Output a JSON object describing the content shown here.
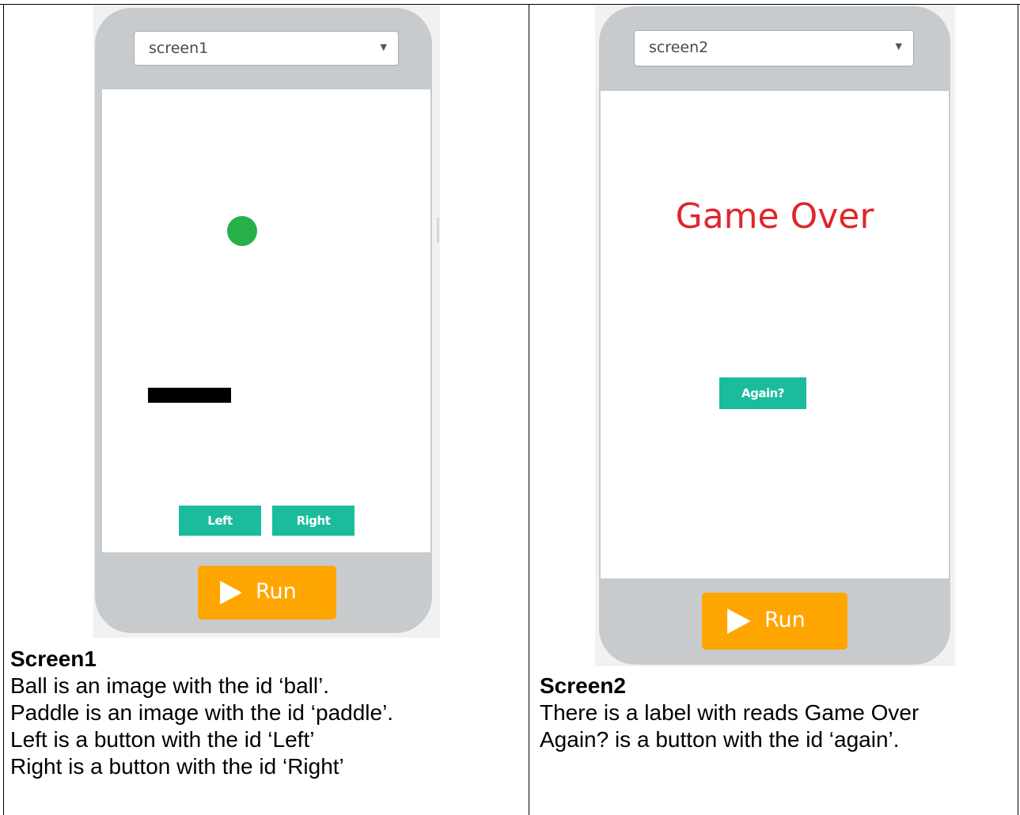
{
  "screen1": {
    "dropdown_value": "screen1",
    "left_button": "Left",
    "right_button": "Right",
    "run_button": "Run",
    "caption_title": "Screen1",
    "caption_lines": [
      "Ball is an image with the id ‘ball’.",
      "Paddle is an image with the id ‘paddle’.",
      "Left is a button with the id ‘Left’",
      "Right is a button with the id ‘Right’"
    ]
  },
  "screen2": {
    "dropdown_value": "screen2",
    "label": "Game Over",
    "again_button": "Again?",
    "run_button": "Run",
    "caption_title": "Screen2",
    "caption_lines": [
      "There is a label with reads Game Over",
      "Again? is a button with the id ‘again’."
    ]
  },
  "colors": {
    "ball": "#26b048",
    "app_button": "#1abc9c",
    "run_button": "#ffa500",
    "game_over_text": "#e0262c",
    "phone_frame": "#c8cbce"
  },
  "icons": {
    "dropdown": "triangle-down",
    "run": "play-triangle"
  }
}
